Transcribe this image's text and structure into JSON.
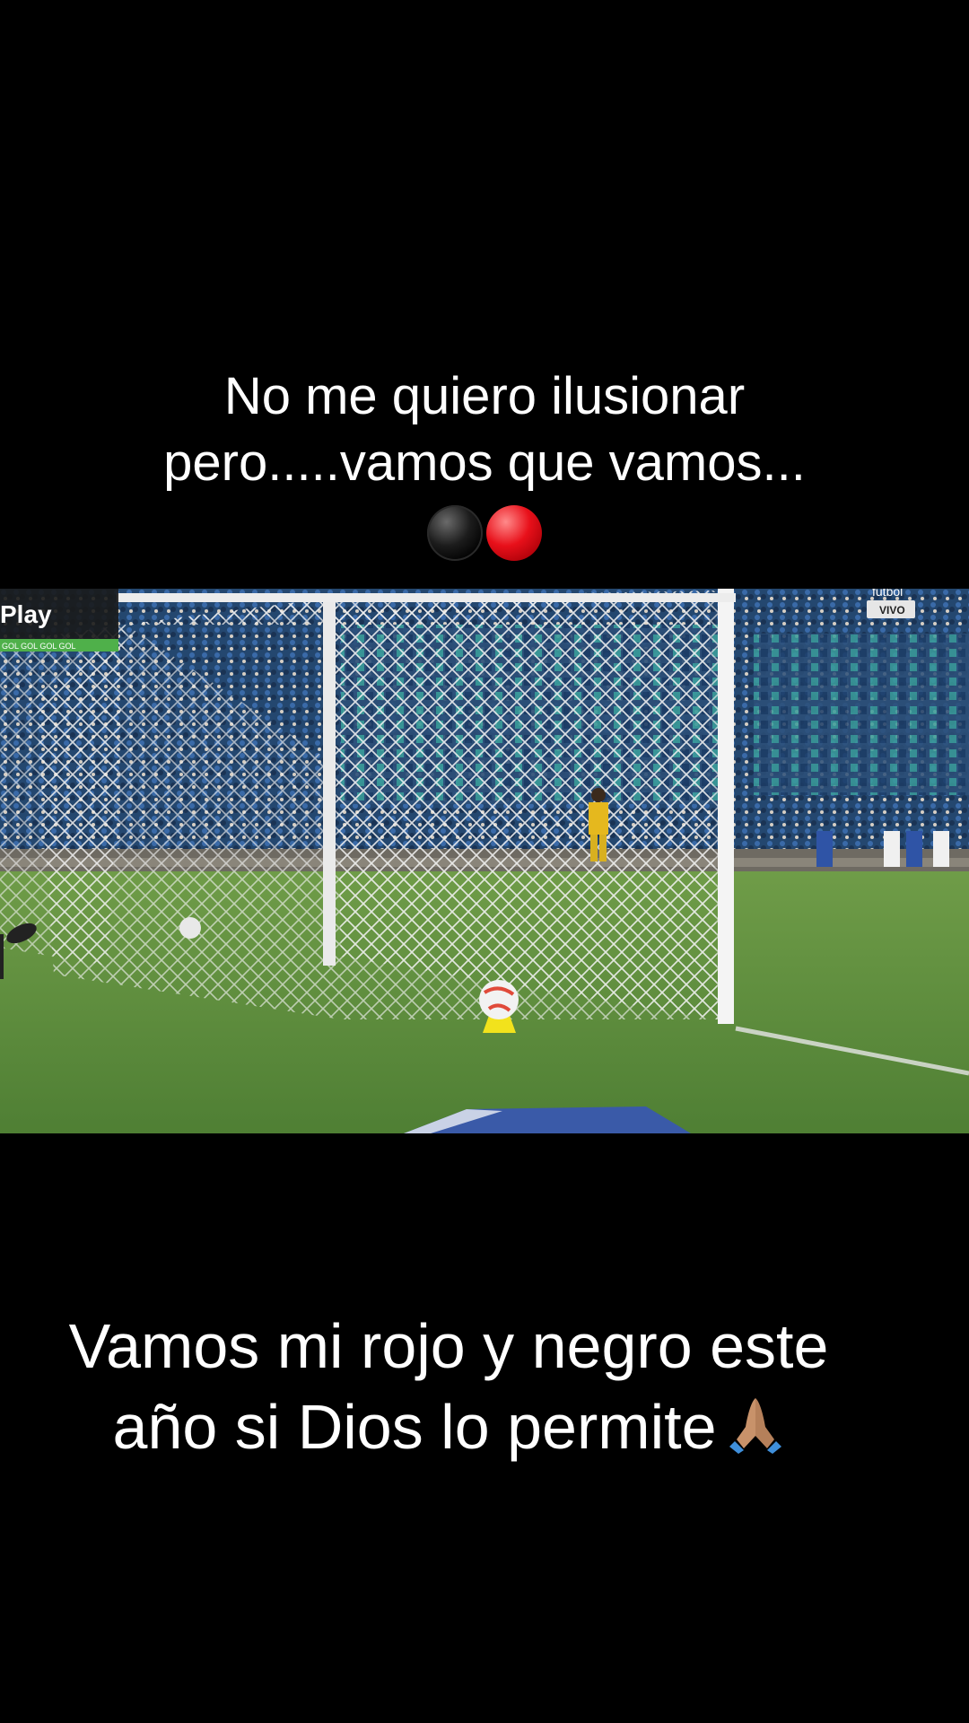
{
  "caption_top": {
    "line1": "No me quiero ilusionar",
    "line2": "pero.....vamos que vamos...",
    "emoji": [
      "black-circle",
      "red-circle"
    ]
  },
  "video": {
    "broadcaster_logo": "Play",
    "live_top_text": "futbol",
    "live_badge": "VIVO",
    "ticker": "GOL GOL GOL GOL",
    "colors": {
      "grass": "#5c8c3a",
      "stands": "#2f5d8c",
      "net": "#ffffff"
    }
  },
  "caption_bottom": {
    "line1": "Vamos mi rojo y negro este",
    "line2": "año si Dios lo permite",
    "emoji": "folded-hands"
  }
}
